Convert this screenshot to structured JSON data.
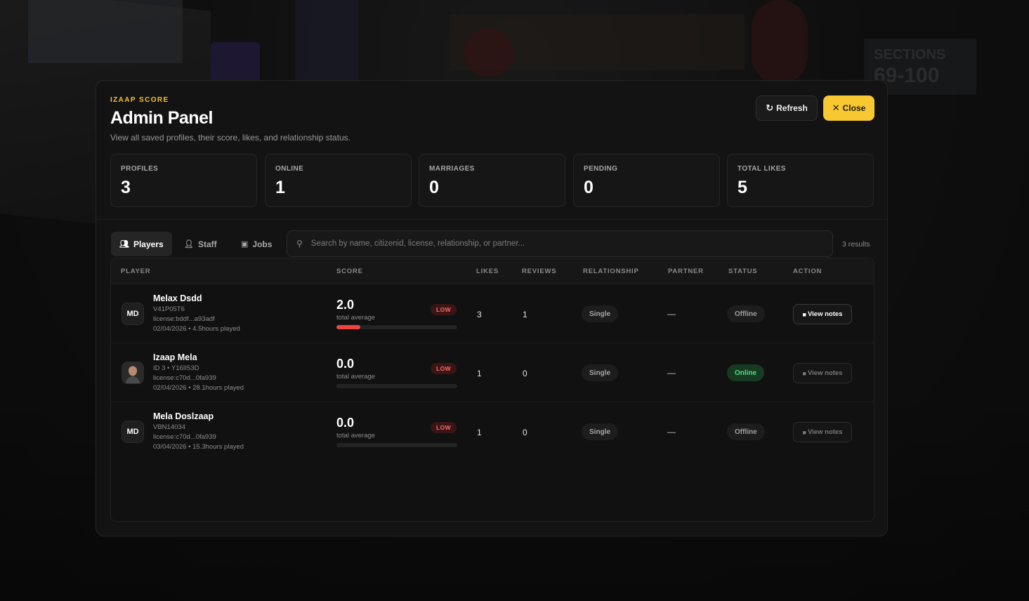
{
  "header": {
    "eyebrow": "IZAAP SCORE",
    "title": "Admin Panel",
    "subtitle": "View all saved profiles, their score, likes, and relationship status.",
    "refresh_label": "Refresh",
    "close_label": "Close"
  },
  "stats": [
    {
      "label": "PROFILES",
      "value": "3"
    },
    {
      "label": "ONLINE",
      "value": "1"
    },
    {
      "label": "MARRIAGES",
      "value": "0"
    },
    {
      "label": "PENDING",
      "value": "0"
    },
    {
      "label": "TOTAL LIKES",
      "value": "5"
    }
  ],
  "tabs": [
    {
      "label": "Players",
      "icon": "users-icon",
      "active": true
    },
    {
      "label": "Staff",
      "icon": "user-shield-icon",
      "active": false
    },
    {
      "label": "Jobs",
      "icon": "briefcase-icon",
      "active": false
    }
  ],
  "search": {
    "placeholder": "Search by name, citizenid, license, relationship, or partner...",
    "value": ""
  },
  "results_text": "3 results",
  "columns": [
    "PLAYER",
    "SCORE",
    "LIKES",
    "REVIEWS",
    "RELATIONSHIP",
    "PARTNER",
    "STATUS",
    "ACTION"
  ],
  "rows": [
    {
      "initials": "MD",
      "avatar": "initials",
      "name": "Melax Dsdd",
      "id_line": "V41P05T6",
      "license": "license:bddf...a93adf",
      "played": "02/04/2026 • 4.5hours played",
      "score": "2.0",
      "score_label": "total average",
      "score_badge": "LOW",
      "score_fraction": 0.2,
      "likes": "3",
      "reviews": "1",
      "relationship": "Single",
      "partner": "—",
      "status": "Offline",
      "online": false,
      "action": "View notes",
      "action_enabled": true
    },
    {
      "initials": "",
      "avatar": "photo",
      "name": "Izaap Mela",
      "id_line": "ID 3 • Y16II53D",
      "license": "license:c70d...0fa939",
      "played": "02/04/2026 • 28.1hours played",
      "score": "0.0",
      "score_label": "total average",
      "score_badge": "LOW",
      "score_fraction": 0,
      "likes": "1",
      "reviews": "0",
      "relationship": "Single",
      "partner": "—",
      "status": "Online",
      "online": true,
      "action": "View notes",
      "action_enabled": false
    },
    {
      "initials": "MD",
      "avatar": "initials",
      "name": "Mela Doslzaap",
      "id_line": "VBN14034",
      "license": "license:c70d...0fa939",
      "played": "03/04/2026 • 15.3hours played",
      "score": "0.0",
      "score_label": "total average",
      "score_badge": "LOW",
      "score_fraction": 0,
      "likes": "1",
      "reviews": "0",
      "relationship": "Single",
      "partner": "—",
      "status": "Offline",
      "online": false,
      "action": "View notes",
      "action_enabled": false
    }
  ],
  "colors": {
    "accent": "#f7c830",
    "danger": "#ef4444",
    "online": "#4ade80",
    "panel": "#131313"
  }
}
